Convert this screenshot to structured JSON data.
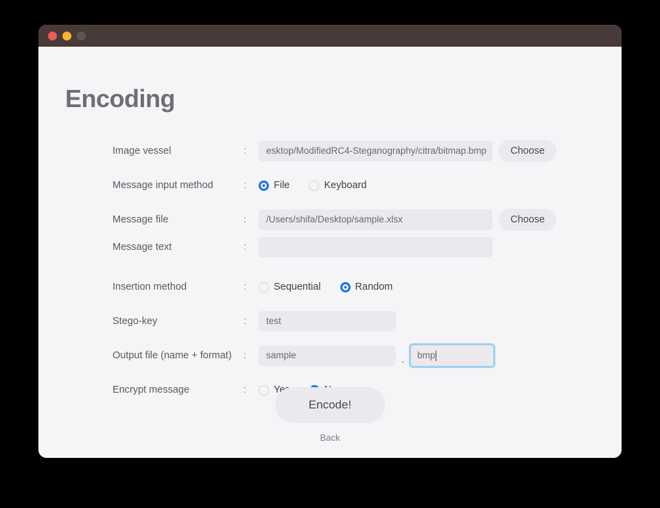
{
  "window": {
    "titlebar_buttons": [
      "close",
      "minimize",
      "maximize"
    ],
    "accent_color": "#1a73e8",
    "titlebar_color": "#473a38",
    "background_color": "#f5f5f7",
    "field_color": "#ebe9ed",
    "focus_ring_color": "#9fd0f0"
  },
  "page": {
    "title": "Encoding",
    "colon": ":"
  },
  "form": {
    "image_vessel": {
      "label": "Image vessel",
      "value": "esktop/ModifiedRC4-Steganography/citra/bitmap.bmp",
      "placeholder": "",
      "choose_label": "Choose"
    },
    "message_input_method": {
      "label": "Message input method",
      "options": [
        {
          "label": "File",
          "selected": true
        },
        {
          "label": "Keyboard",
          "selected": false
        }
      ]
    },
    "message_file": {
      "label": "Message file",
      "value": "/Users/shifa/Desktop/sample.xlsx",
      "placeholder": "",
      "choose_label": "Choose"
    },
    "message_text": {
      "label": "Message text",
      "value": "",
      "placeholder": ""
    },
    "insertion_method": {
      "label": "Insertion method",
      "options": [
        {
          "label": "Sequential",
          "selected": false
        },
        {
          "label": "Random",
          "selected": true
        }
      ]
    },
    "stego_key": {
      "label": "Stego-key",
      "value": "test",
      "placeholder": ""
    },
    "output_file": {
      "label": "Output file (name + format)",
      "name_value": "sample",
      "name_placeholder": "",
      "separator": ".",
      "ext_value": "bmp",
      "ext_placeholder": "",
      "ext_focused": true
    },
    "encrypt_message": {
      "label": "Encrypt message",
      "options": [
        {
          "label": "Yes",
          "selected": false
        },
        {
          "label": "No",
          "selected": true
        }
      ]
    }
  },
  "footer": {
    "submit_label": "Encode!",
    "back_label": "Back"
  }
}
